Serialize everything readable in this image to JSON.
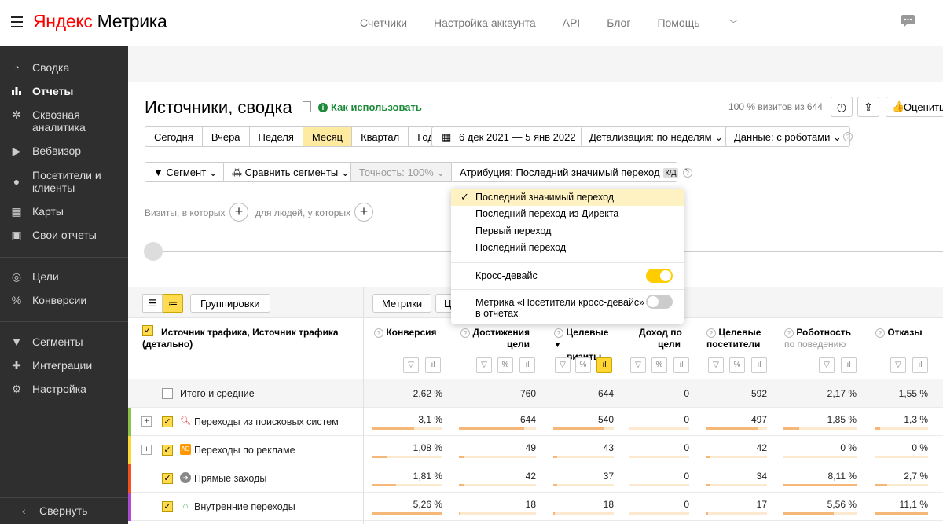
{
  "app": {
    "logo_brand": "Яндекс",
    "logo_product": "Метрика"
  },
  "topnav": [
    "Счетчики",
    "Настройка аккаунта",
    "API",
    "Блог",
    "Помощь"
  ],
  "sidebar": {
    "items": [
      {
        "label": "Сводка",
        "icon": "gauge-icon"
      },
      {
        "label": "Отчеты",
        "icon": "bar-chart-icon"
      },
      {
        "label": "Сквозная аналитика",
        "icon": "asterisk-icon"
      },
      {
        "label": "Вебвизор",
        "icon": "play-icon"
      },
      {
        "label": "Посетители и клиенты",
        "icon": "person-icon"
      },
      {
        "label": "Карты",
        "icon": "map-icon"
      },
      {
        "label": "Свои отчеты",
        "icon": "folder-icon"
      },
      {
        "label": "Цели",
        "icon": "target-icon"
      },
      {
        "label": "Конверсии",
        "icon": "percent-icon"
      },
      {
        "label": "Сегменты",
        "icon": "filter-icon"
      },
      {
        "label": "Интеграции",
        "icon": "puzzle-icon"
      },
      {
        "label": "Настройка",
        "icon": "gear-icon"
      }
    ],
    "collapse": "Свернуть"
  },
  "page": {
    "title": "Источники, сводка",
    "howto": "Как использовать",
    "visits": "100 % визитов из 644",
    "rate": "Оценить"
  },
  "periods": {
    "items": [
      "Сегодня",
      "Вчера",
      "Неделя",
      "Месяц",
      "Квартал",
      "Год"
    ],
    "selected": "Месяц"
  },
  "filters": {
    "date_range": "6 дек 2021 — 5 янв 2022",
    "detail": "Детализация: по неделям",
    "data": "Данные: с роботами",
    "segment": "Сегмент",
    "compare": "Сравнить сегменты",
    "accuracy": "Точность: 100%",
    "attribution": "Атрибуция: Последний значимый переход",
    "kd": "К/Д"
  },
  "visit_filter": {
    "left": "Визиты, в которых",
    "right": "для людей, у которых"
  },
  "table_bar": {
    "groups": "Группировки",
    "metrics": "Метрики",
    "cut": "Це"
  },
  "columns": {
    "dimension": "Источник трафика, Источник трафика (детально)",
    "conversion": "Конверсия",
    "goals_l1": "Достижения",
    "goals_l2": "цели",
    "target_l1": "Целевые",
    "target_l2": "визиты",
    "income_l1": "Доход по",
    "income_l2": "цели",
    "tvisitors_l1": "Целевые",
    "tvisitors_l2": "посетители",
    "robot_l1": "Роботность",
    "robot_l2": "по поведению",
    "bounce": "Отказы"
  },
  "total": {
    "label": "Итого и средние",
    "values": [
      "2,62 %",
      "760",
      "644",
      "0",
      "592",
      "2,17 %",
      "1,55 %"
    ]
  },
  "rows": [
    {
      "label": "Переходы из поисковых систем",
      "color": "#8bc34a",
      "icon": "search-icon",
      "values": [
        "3,1 %",
        "644",
        "540",
        "0",
        "497",
        "1,85 %",
        "1,3 %"
      ],
      "fills": [
        0.59,
        0.85,
        0.84,
        0,
        0.84,
        0.22,
        0.11
      ]
    },
    {
      "label": "Переходы по рекламе",
      "color": "#ffd633",
      "icon": "ad-icon",
      "values": [
        "1,08 %",
        "49",
        "43",
        "0",
        "42",
        "0 %",
        "0 %"
      ],
      "fills": [
        0.2,
        0.06,
        0.07,
        0,
        0.07,
        0,
        0
      ]
    },
    {
      "label": "Прямые заходы",
      "color": "#f4511e",
      "icon": "arrow-enter-icon",
      "values": [
        "1,81 %",
        "42",
        "37",
        "0",
        "34",
        "8,11 %",
        "2,7 %"
      ],
      "fills": [
        0.34,
        0.06,
        0.06,
        0,
        0.06,
        1,
        0.24
      ]
    },
    {
      "label": "Внутренние переходы",
      "color": "#b04bd1",
      "icon": "home-icon",
      "values": [
        "5,26 %",
        "18",
        "18",
        "0",
        "17",
        "5,56 %",
        "11,1 %"
      ],
      "fills": [
        1,
        0.02,
        0.03,
        0,
        0.03,
        0.69,
        1
      ]
    }
  ],
  "dropdown": {
    "options": [
      "Последний значимый переход",
      "Последний переход из Директа",
      "Первый переход",
      "Последний переход"
    ],
    "selected": 0,
    "cross_device": "Кросс-девайс",
    "cross_device_on": true,
    "metric_label": "Метрика «Посетители кросс-девайс» в отчетах",
    "metric_on": false
  }
}
